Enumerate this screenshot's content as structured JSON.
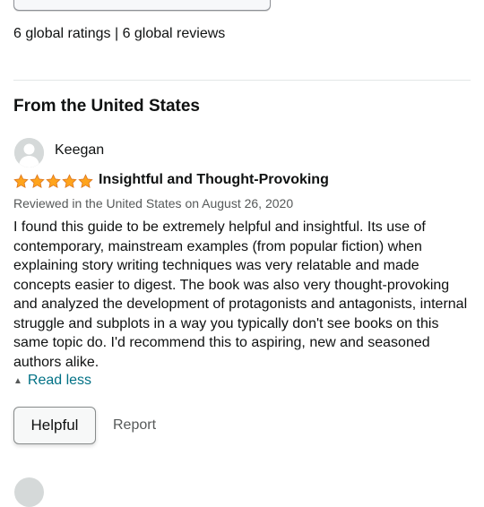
{
  "summary": {
    "ratings_text": "6 global ratings | 6 global reviews"
  },
  "section": {
    "title": "From the United States"
  },
  "review": {
    "reviewer_name": "Keegan",
    "rating": 5,
    "max_rating": 5,
    "star_color": "#ffa41c",
    "title": "Insightful and Thought-Provoking",
    "meta": "Reviewed in the United States on August 26, 2020",
    "body": "I found this guide to be extremely helpful and insightful. Its use of contemporary, mainstream examples (from popular fiction) when explaining story writing techniques was very relatable and made concepts easier to digest. The book was also very thought-provoking and analyzed the development of protagonists and antagonists, internal struggle and subplots in a way you typically don't see books on this same topic do. I'd recommend this to aspiring, new and seasoned authors alike.",
    "read_less_label": "Read less",
    "helpful_label": "Helpful",
    "report_label": "Report"
  },
  "icons": {
    "avatar": "default-user-avatar-icon",
    "star": "star-icon",
    "caret": "caret-up-icon"
  }
}
